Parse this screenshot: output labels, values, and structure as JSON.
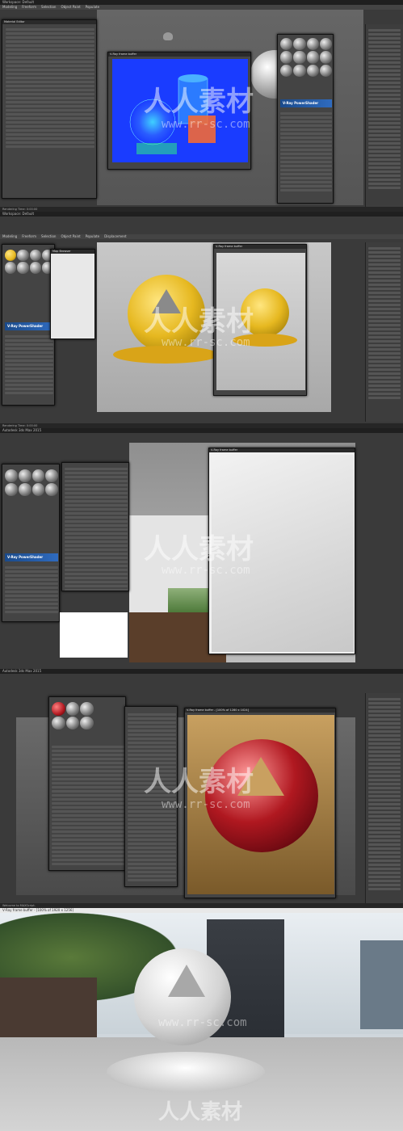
{
  "sections": [
    {
      "titlebar": "Workspace: Default",
      "menu": [
        "Modeling",
        "Freeform",
        "Selection",
        "Object Paint",
        "Populate"
      ],
      "render_window_title": "V-Ray frame buffer",
      "vray_banner": "V-Ray PowerShader",
      "status": "Rendering Time: 0:00:00"
    },
    {
      "titlebar": "Workspace: Default",
      "menu": [
        "Modeling",
        "Freeform",
        "Selection",
        "Object Paint",
        "Populate",
        "Displacement"
      ],
      "render_window_title": "V-Ray frame buffer",
      "vray_banner": "V-Ray PowerShader",
      "status": "Rendering Time: 0:00:00"
    },
    {
      "titlebar": "Autodesk 3ds Max 2015",
      "menu": [],
      "render_window_title": "V-Ray frame buffer",
      "vray_banner": "V-Ray PowerShader",
      "status": ""
    },
    {
      "titlebar": "Autodesk 3ds Max 2015",
      "menu": [],
      "render_window_title": "V-Ray frame buffer - [100% of 1280 x 1024]",
      "vray_banner": "",
      "status": "Welcome to MAXScript."
    },
    {
      "titlebar": "V-Ray frame buffer - [100% of 1920 x 1256]",
      "menu": [],
      "render_window_title": "",
      "vray_banner": "",
      "status": ""
    }
  ],
  "watermark": {
    "brand": "人人素材",
    "url": "www.rr-sc.com"
  },
  "colors": {
    "ui_dark": "#3a3a3a",
    "vray_blue": "#2f6bbf",
    "yellow_material": "#e6b820",
    "red_material": "#b01820"
  }
}
